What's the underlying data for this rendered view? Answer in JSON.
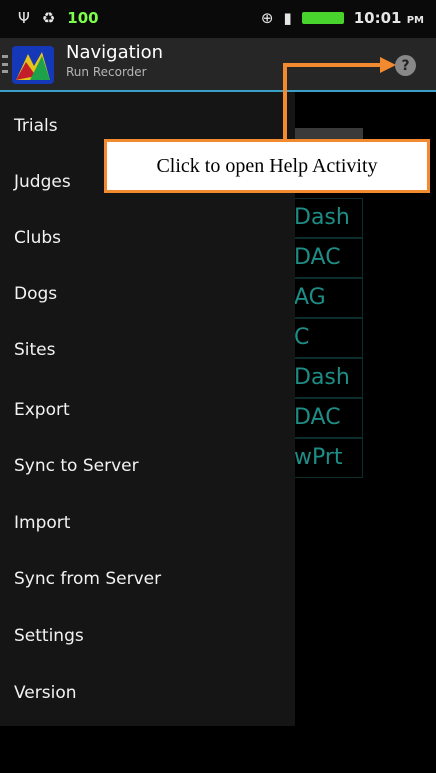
{
  "status_bar": {
    "left_icons": [
      "usb-icon",
      "sync-icon"
    ],
    "battery_level": "100",
    "right_icons": [
      "gps-icon",
      "signal-icon",
      "battery-icon"
    ],
    "time": "10:01",
    "ampm": "PM"
  },
  "action_bar": {
    "title": "Navigation",
    "subtitle": "Run Recorder",
    "help_glyph": "?"
  },
  "background_list": {
    "visible_fragments": [
      "Dash",
      "DAC",
      "AG",
      "C",
      "Dash",
      "DAC",
      "wPrt"
    ]
  },
  "drawer": {
    "items": [
      {
        "label": "Trials"
      },
      {
        "label": "Judges"
      },
      {
        "label": "Clubs"
      },
      {
        "label": "Dogs"
      },
      {
        "label": "Sites"
      },
      {
        "label": "Export"
      },
      {
        "label": "Sync to Server"
      },
      {
        "label": "Import"
      },
      {
        "label": "Sync from Server"
      },
      {
        "label": "Settings"
      },
      {
        "label": "Version"
      }
    ]
  },
  "annotation": {
    "text": "Click to open Help Activity",
    "color": "#f28a30"
  },
  "colors": {
    "accent_line": "#3aa0c8",
    "drawer_bg": "#151515",
    "list_text": "#1d8d86"
  }
}
